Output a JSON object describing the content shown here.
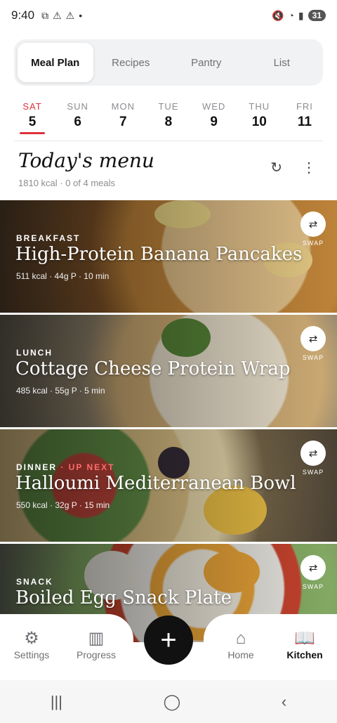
{
  "status": {
    "time": "9:40",
    "battery": "31"
  },
  "tabs": [
    {
      "label": "Meal Plan",
      "active": true
    },
    {
      "label": "Recipes",
      "active": false
    },
    {
      "label": "Pantry",
      "active": false
    },
    {
      "label": "List",
      "active": false
    }
  ],
  "week": [
    {
      "name": "SAT",
      "num": "5"
    },
    {
      "name": "SUN",
      "num": "6"
    },
    {
      "name": "MON",
      "num": "7"
    },
    {
      "name": "TUE",
      "num": "8"
    },
    {
      "name": "WED",
      "num": "9"
    },
    {
      "name": "THU",
      "num": "10"
    },
    {
      "name": "FRI",
      "num": "11"
    }
  ],
  "today": {
    "title": "Today's menu",
    "summary": "1810 kcal · 0 of 4 meals"
  },
  "meals": [
    {
      "type": "BREAKFAST",
      "upnext": "",
      "name": "High-Protein Banana Pancakes",
      "meta": "511 kcal · 44g P · 10 min",
      "swap": "SWAP"
    },
    {
      "type": "LUNCH",
      "upnext": "",
      "name": "Cottage Cheese Protein Wrap",
      "meta": "485 kcal · 55g P · 5 min",
      "swap": "SWAP"
    },
    {
      "type": "DINNER",
      "upnext": " · UP NEXT",
      "name": "Halloumi Mediterranean Bowl",
      "meta": "550 kcal · 32g P · 15 min",
      "swap": "SWAP"
    },
    {
      "type": "SNACK",
      "upnext": "",
      "name": "Boiled Egg Snack Plate",
      "meta": "",
      "swap": "SWAP"
    }
  ],
  "nav": {
    "settings": "Settings",
    "progress": "Progress",
    "home": "Home",
    "kitchen": "Kitchen"
  },
  "icons": [
    "gear-icon",
    "chart-icon",
    "plus-icon",
    "home-icon",
    "book-icon",
    "refresh-icon",
    "more-icon",
    "swap-icon"
  ]
}
